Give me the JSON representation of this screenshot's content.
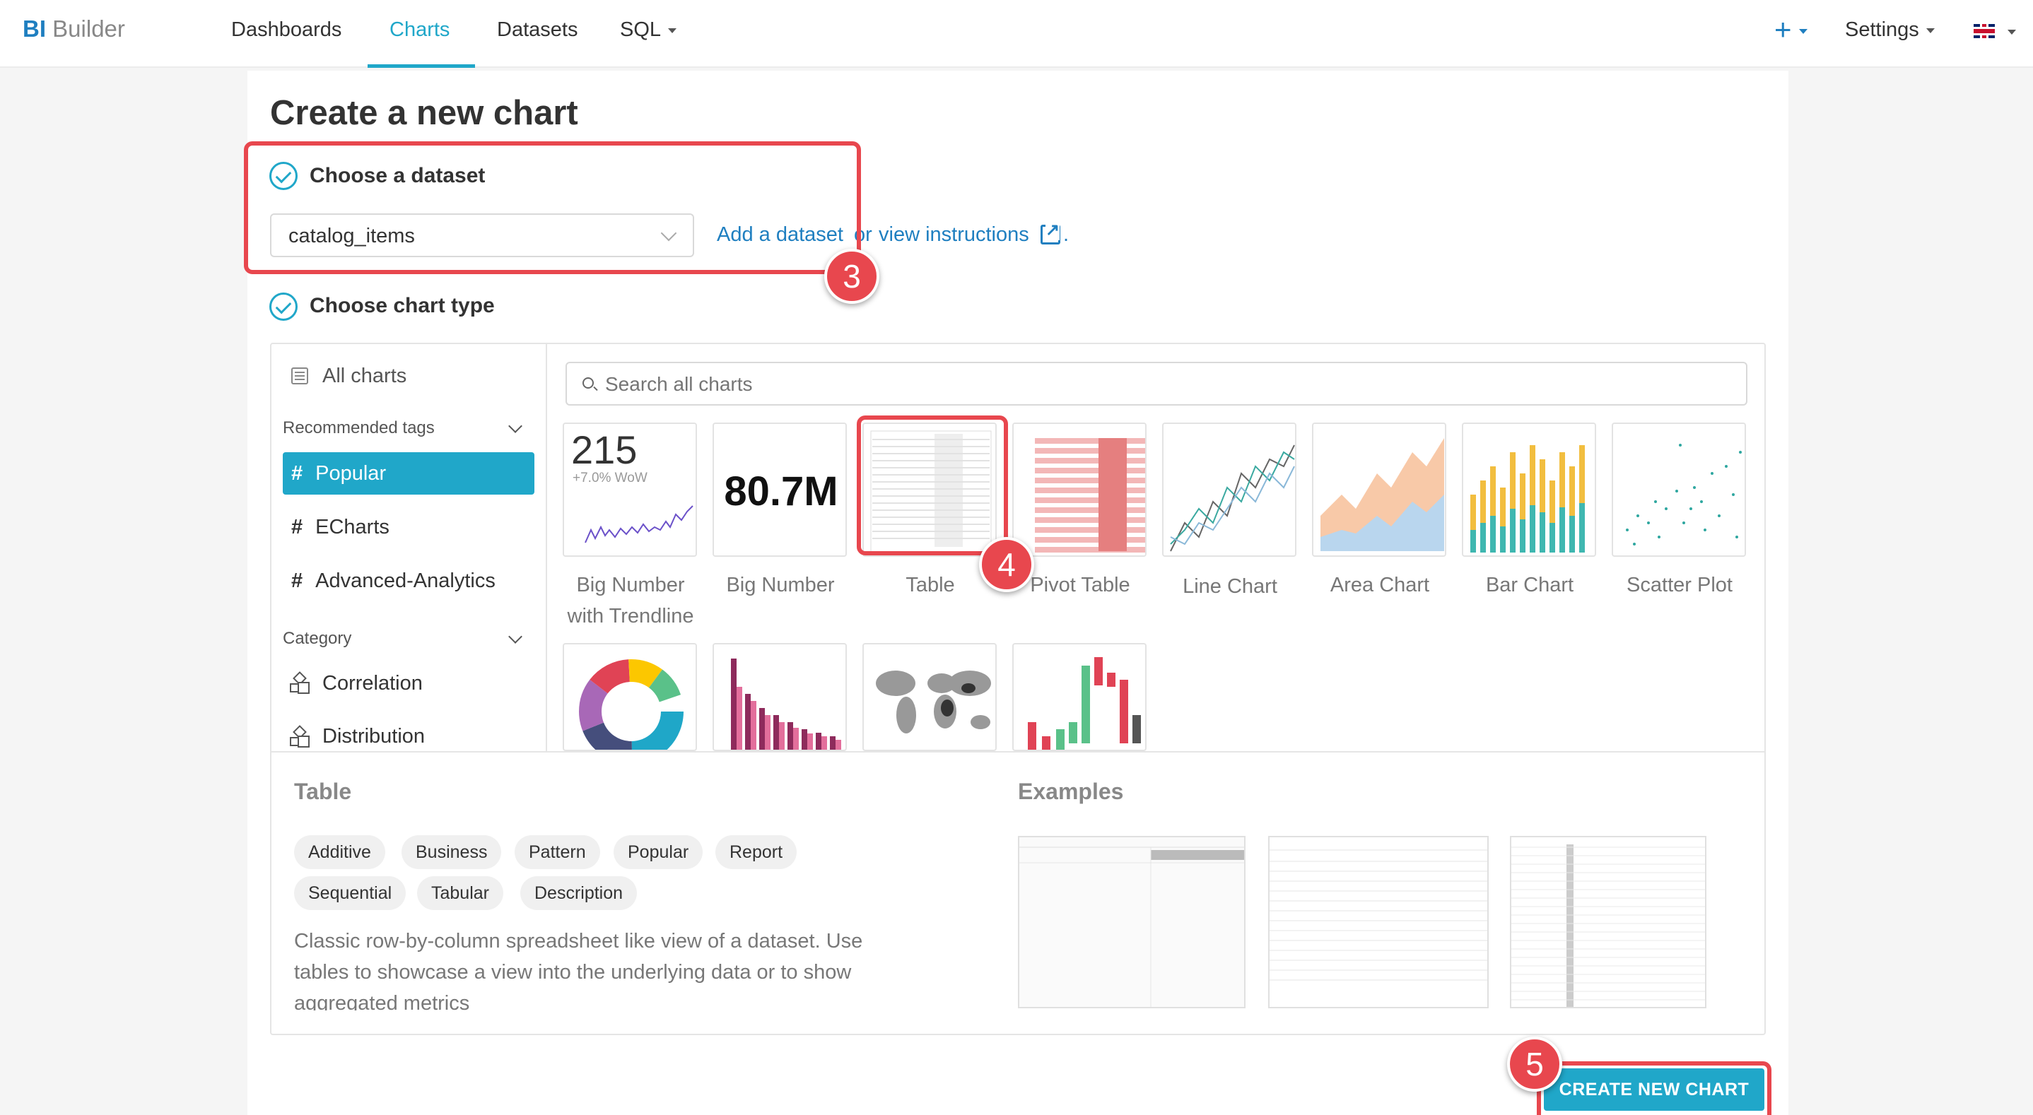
{
  "nav": {
    "brand_bi": "BI",
    "brand_name": "Builder",
    "links": [
      "Dashboards",
      "Charts",
      "Datasets",
      "SQL"
    ],
    "right_plus": "+",
    "right_settings": "Settings"
  },
  "page": {
    "title": "Create a new chart",
    "step1_label": "Choose a dataset",
    "dataset_value": "catalog_items",
    "add_dataset_link": "Add a dataset",
    "or_text": "or",
    "view_instructions_link": "view instructions",
    "period": ".",
    "step2_label": "Choose chart type"
  },
  "sidebar": {
    "all_charts": "All charts",
    "recommended_tags": "Recommended tags",
    "tags": [
      "Popular",
      "ECharts",
      "Advanced-Analytics"
    ],
    "category": "Category",
    "categories": [
      "Correlation",
      "Distribution"
    ]
  },
  "search": {
    "placeholder": "Search all charts"
  },
  "charts": {
    "big_number_trend_value": "215",
    "big_number_trend_sub": "+7.0% WoW",
    "big_number_value": "80.7M",
    "labels": [
      "Big Number with Trendline",
      "Big Number",
      "Table",
      "Pivot Table",
      "Line Chart",
      "Area Chart",
      "Bar Chart",
      "Scatter Plot"
    ]
  },
  "details": {
    "title": "Table",
    "examples_title": "Examples",
    "tags": [
      "Additive",
      "Business",
      "Pattern",
      "Popular",
      "Report",
      "Sequential",
      "Tabular",
      "Description"
    ],
    "description": "Classic row-by-column spreadsheet like view of a dataset. Use tables to showcase a view into the underlying data or to show aggregated metrics"
  },
  "create_button": "CREATE NEW CHART",
  "annotations": {
    "step3": "3",
    "step4": "4",
    "step5": "5"
  },
  "colors": {
    "accent": "#20a7c9",
    "link": "#1f7fc0",
    "highlight": "#e8474e"
  }
}
